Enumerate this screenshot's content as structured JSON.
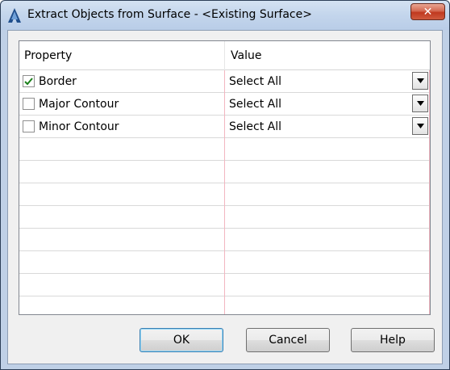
{
  "window": {
    "title": "Extract Objects from Surface - <Existing Surface>",
    "close_label": "✕"
  },
  "grid": {
    "columns": [
      "Property",
      "Value"
    ],
    "rows": [
      {
        "label": "Border",
        "checked": true,
        "value": "Select All"
      },
      {
        "label": "Major Contour",
        "checked": false,
        "value": "Select All"
      },
      {
        "label": "Minor Contour",
        "checked": false,
        "value": "Select All"
      }
    ],
    "empty_rows": 8
  },
  "buttons": {
    "ok": "OK",
    "cancel": "Cancel",
    "help": "Help"
  },
  "colors": {
    "check": "#1a7f1a",
    "column_separator": "#f2b6c0",
    "title_accent": "#1f4e8c"
  }
}
